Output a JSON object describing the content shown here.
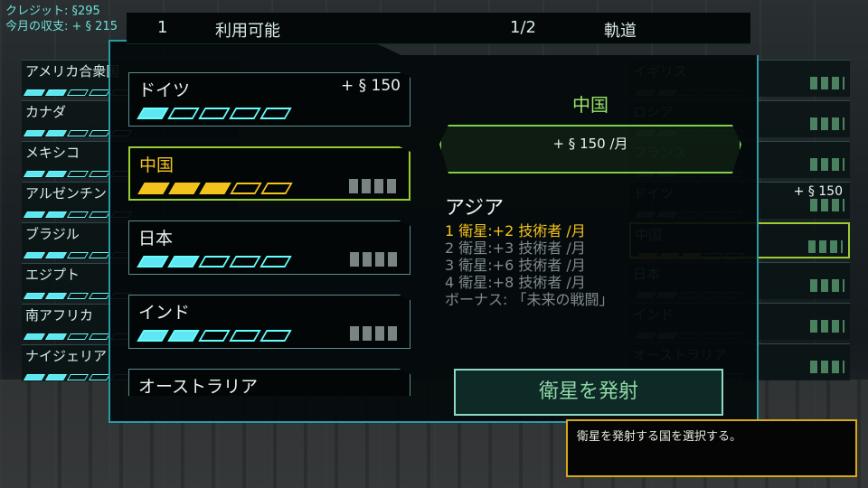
{
  "hud": {
    "credits": "クレジット: §295",
    "monthly": "今月の収支: + § 215"
  },
  "topbar": {
    "count": "1",
    "available": "利用可能",
    "page": "1/2",
    "orbit": "軌道"
  },
  "left_list": [
    {
      "name": "アメリカ合衆国",
      "filled": 2,
      "total": 5
    },
    {
      "name": "カナダ",
      "filled": 2,
      "total": 5
    },
    {
      "name": "メキシコ",
      "filled": 2,
      "total": 5
    },
    {
      "name": "アルゼンチン",
      "filled": 2,
      "total": 5
    },
    {
      "name": "ブラジル",
      "filled": 2,
      "total": 5
    },
    {
      "name": "エジプト",
      "filled": 2,
      "total": 5
    },
    {
      "name": "南アフリカ",
      "filled": 2,
      "total": 5
    },
    {
      "name": "ナイジェリア",
      "filled": 2,
      "total": 5
    }
  ],
  "country_cards": [
    {
      "name": "ドイツ",
      "amount": "+ § 150",
      "filled": 1,
      "total": 5,
      "selected": false
    },
    {
      "name": "中国",
      "amount": "",
      "filled": 3,
      "total": 5,
      "selected": true
    },
    {
      "name": "日本",
      "amount": "",
      "filled": 2,
      "total": 5,
      "selected": false
    },
    {
      "name": "インド",
      "amount": "",
      "filled": 2,
      "total": 5,
      "selected": false
    },
    {
      "name": "オーストラリア",
      "amount": "",
      "filled": 0,
      "total": 5,
      "selected": false
    }
  ],
  "detail": {
    "country": "中国",
    "income": "+ § 150 /月",
    "region": "アジア",
    "bonuses": [
      "1 衛星:+2 技術者 /月",
      "2 衛星:+3 技術者 /月",
      "3 衛星:+6 技術者 /月",
      "4 衛星:+8 技術者 /月",
      "ボーナス: 「未来の戦闘」"
    ],
    "launch_label": "衛星を発射"
  },
  "right_list": [
    {
      "name": "イギリス",
      "amount": ""
    },
    {
      "name": "ロシア",
      "amount": ""
    },
    {
      "name": "フランス",
      "amount": ""
    },
    {
      "name": "ドイツ",
      "amount": "+ § 150"
    },
    {
      "name": "中国",
      "amount": ""
    },
    {
      "name": "日本",
      "amount": ""
    },
    {
      "name": "インド",
      "amount": ""
    },
    {
      "name": "オーストラリア",
      "amount": ""
    }
  ],
  "tooltip": "衛星を発射する国を選択する。",
  "colors": {
    "accent_cyan": "#5fe6f0",
    "selected_yellow": "#f4c21c",
    "selected_green": "#9acd32",
    "tip_border": "#d9a81a"
  }
}
